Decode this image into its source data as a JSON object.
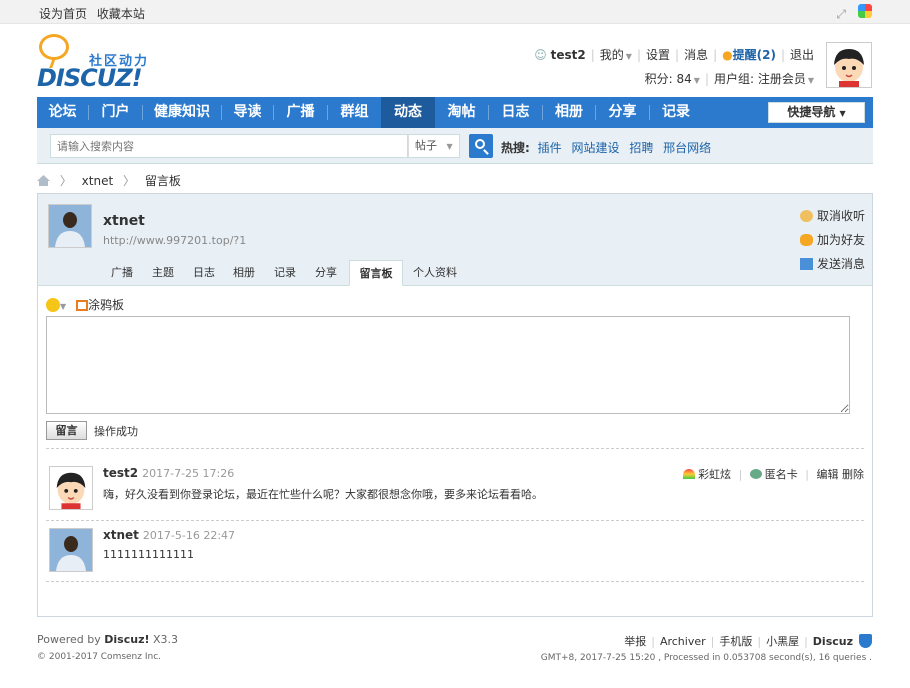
{
  "topbar": {
    "set_home": "设为首页",
    "bookmark": "收藏本站"
  },
  "logo": {
    "subtitle": "社区动力",
    "brand": "DISCUZ!"
  },
  "user": {
    "name": "test2",
    "my": "我的",
    "settings": "设置",
    "messages": "消息",
    "remind": "提醒(2)",
    "logout": "退出",
    "points": "积分: 84",
    "group": "用户组: 注册会员"
  },
  "nav": {
    "items": [
      "论坛",
      "门户",
      "健康知识",
      "导读",
      "广播",
      "群组",
      "动态",
      "淘帖",
      "日志",
      "相册",
      "分享",
      "记录"
    ],
    "active": "动态",
    "quick": "快捷导航"
  },
  "search": {
    "placeholder": "请输入搜索内容",
    "type": "帖子",
    "hot_label": "热搜:",
    "hot": [
      "插件",
      "网站建设",
      "招聘",
      "邢台网络"
    ]
  },
  "breadcrumb": {
    "items": [
      "xtnet",
      "留言板"
    ]
  },
  "profile": {
    "name": "xtnet",
    "url": "http://www.997201.top/?1",
    "tabs": [
      "广播",
      "主题",
      "日志",
      "相册",
      "记录",
      "分享",
      "留言板",
      "个人资料"
    ],
    "active_tab": "留言板",
    "actions": {
      "unfollow": "取消收听",
      "add_friend": "加为好友",
      "send_msg": "发送消息"
    }
  },
  "board": {
    "graffiti": "涂鸦板",
    "submit": "留言",
    "status": "操作成功"
  },
  "comments": [
    {
      "author": "test2",
      "time": "2017-7-25 17:26",
      "text": "嗨，好久没看到你登录论坛，最近在忙些什么呢？大家都很想念你哦，要多来论坛看看哈。",
      "ops": {
        "rainbow": "彩虹炫",
        "anonymous": "匿名卡",
        "edit": "编辑",
        "delete": "删除"
      }
    },
    {
      "author": "xtnet",
      "time": "2017-5-16 22:47",
      "text": "1111111111111"
    }
  ],
  "footer": {
    "powered_by": "Powered by",
    "brand": "Discuz!",
    "version": "X3.3",
    "copyright": "© 2001-2017 Comsenz Inc.",
    "links": [
      "举报",
      "Archiver",
      "手机版",
      "小黑屋",
      "Discuz"
    ],
    "info": "GMT+8, 2017-7-25 15:20 , Processed in 0.053708 second(s), 16 queries ."
  },
  "colors": {
    "nav_blue": "#2b7acd",
    "nav_active": "#1e5b9c",
    "panel_bg": "#e8eff5",
    "link_blue": "#1e64a8"
  }
}
